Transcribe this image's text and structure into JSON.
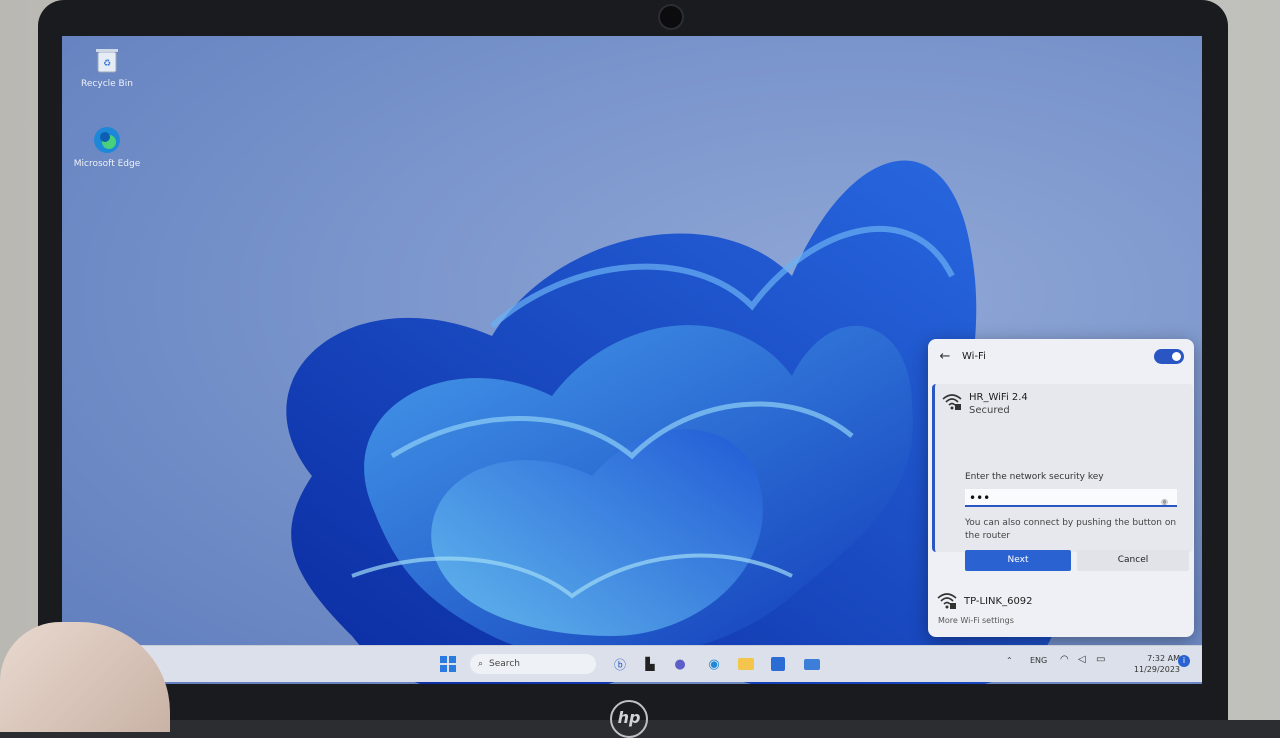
{
  "desktop": {
    "icons": [
      {
        "label": "Recycle Bin",
        "icon": "recycle-bin-icon"
      },
      {
        "label": "Microsoft Edge",
        "icon": "edge-icon"
      }
    ]
  },
  "wifi_panel": {
    "title": "Wi-Fi",
    "toggle_on": true,
    "selected_network": {
      "ssid": "HR_WiFi 2.4",
      "status": "Secured",
      "key_label": "Enter the network security key",
      "key_value": "•••",
      "hint": "You can also connect by pushing the button on the router",
      "next_label": "Next",
      "cancel_label": "Cancel"
    },
    "other_networks": [
      {
        "ssid": "TP-LINK_6092"
      }
    ],
    "more_settings_label": "More Wi-Fi settings"
  },
  "taskbar": {
    "search_placeholder": "Search",
    "language": "ENG",
    "time": "7:32 AM",
    "date": "11/29/2023"
  },
  "colors": {
    "accent": "#2a62d2",
    "panel_bg": "#eef0f5",
    "taskbar_bg": "#dbe0ea"
  }
}
